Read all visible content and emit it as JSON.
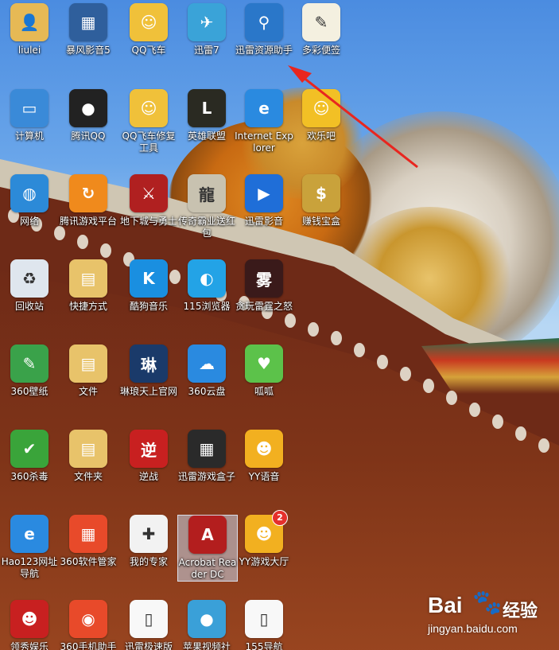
{
  "desktop": {
    "icons": [
      {
        "id": "liulei",
        "label": "liulei",
        "icon": "user-folder-icon",
        "color": "#e6b955"
      },
      {
        "id": "baofeng",
        "label": "暴风影音5",
        "icon": "film-icon",
        "color": "#2f5f9c"
      },
      {
        "id": "qqspeed",
        "label": "QQ飞车",
        "icon": "game-avatar-icon",
        "color": "#f0c13a"
      },
      {
        "id": "xunlei7",
        "label": "迅雷7",
        "icon": "bird-icon",
        "color": "#3aa3d8"
      },
      {
        "id": "xlzyzs",
        "label": "迅雷资源助手",
        "icon": "search-icon",
        "color": "#2a77c9"
      },
      {
        "id": "dcbq",
        "label": "多彩便签",
        "icon": "notepad-icon",
        "color": "#f4f0e0"
      },
      {
        "id": "computer",
        "label": "计算机",
        "icon": "computer-icon",
        "color": "#3a8ad8"
      },
      {
        "id": "tencentqq",
        "label": "腾讯QQ",
        "icon": "penguin-icon",
        "color": "#222222"
      },
      {
        "id": "qqspeedfix",
        "label": "QQ飞车修复工具",
        "icon": "game-avatar-icon",
        "color": "#f0c13a"
      },
      {
        "id": "lol",
        "label": "英雄联盟",
        "icon": "lol-icon",
        "color": "#2a2a22"
      },
      {
        "id": "ie",
        "label": "Internet Explorer",
        "icon": "ie-icon",
        "color": "#2a8ae0"
      },
      {
        "id": "huanleba",
        "label": "欢乐吧",
        "icon": "smiley-icon",
        "color": "#f2c025"
      },
      {
        "id": "network",
        "label": "网络",
        "icon": "globe-icon",
        "color": "#2c8ad8"
      },
      {
        "id": "tgp",
        "label": "腾讯游戏平台",
        "icon": "tgp-icon",
        "color": "#f08a1c"
      },
      {
        "id": "dnf",
        "label": "地下城与勇士",
        "icon": "dnf-icon",
        "color": "#b02020"
      },
      {
        "id": "cqby",
        "label": "传奇霸业送红包",
        "icon": "dragon-char-icon",
        "color": "#c8c2b0"
      },
      {
        "id": "xlyy",
        "label": "迅雷影音",
        "icon": "play-icon",
        "color": "#1f6ed8"
      },
      {
        "id": "zqbh",
        "label": "赚钱宝盒",
        "icon": "money-icon",
        "color": "#c9a23b"
      },
      {
        "id": "recycle",
        "label": "回收站",
        "icon": "recycle-bin-icon",
        "color": "#dfe6ee"
      },
      {
        "id": "shortcut",
        "label": "快捷方式",
        "icon": "folder-icon",
        "color": "#e8c36a"
      },
      {
        "id": "kugou",
        "label": "酷狗音乐",
        "icon": "k-icon",
        "color": "#1a8fe0"
      },
      {
        "id": "browser115",
        "label": "115浏览器",
        "icon": "browser-swirl-icon",
        "color": "#23a3e6"
      },
      {
        "id": "tanwan",
        "label": "贪玩雷霆之怒",
        "icon": "fog-char-icon",
        "color": "#3a1a1a"
      },
      {
        "id": "wallpaper",
        "label": "360壁纸",
        "icon": "wallpaper-icon",
        "color": "#3aa24a"
      },
      {
        "id": "wenjian",
        "label": "文件",
        "icon": "folder-icon",
        "color": "#e8c36a"
      },
      {
        "id": "linlang",
        "label": "琳琅天上官网",
        "icon": "game-logo-icon",
        "color": "#1a3a6a"
      },
      {
        "id": "yun360",
        "label": "360云盘",
        "icon": "cloud-icon",
        "color": "#2a8ae0"
      },
      {
        "id": "guagua",
        "label": "呱呱",
        "icon": "frog-icon",
        "color": "#5cc24a"
      },
      {
        "id": "safe360",
        "label": "360杀毒",
        "icon": "shield-icon",
        "color": "#3aa43a"
      },
      {
        "id": "folder",
        "label": "文件夹",
        "icon": "folder-icon",
        "color": "#e8c36a"
      },
      {
        "id": "nizhan",
        "label": "逆战",
        "icon": "nizhan-icon",
        "color": "#c82020"
      },
      {
        "id": "xlyxhz",
        "label": "迅雷游戏盒子",
        "icon": "gamebox-icon",
        "color": "#2a2a2a"
      },
      {
        "id": "yy",
        "label": "YY语音",
        "icon": "raccoon-icon",
        "color": "#f2b020"
      },
      {
        "id": "hao123",
        "label": "Hao123网址导航",
        "icon": "ie-icon",
        "color": "#2a8ae0"
      },
      {
        "id": "soft360",
        "label": "360软件管家",
        "icon": "apps-grid-icon",
        "color": "#e84a2a"
      },
      {
        "id": "expert",
        "label": "我的专家",
        "icon": "doctor-icon",
        "color": "#f2f2f2"
      },
      {
        "id": "acrobat",
        "label": "Acrobat Reader DC",
        "icon": "acrobat-icon",
        "color": "#b31e1e",
        "selected": true
      },
      {
        "id": "yygame",
        "label": "YY游戏大厅",
        "icon": "raccoon-icon",
        "color": "#f2b020",
        "badge": "2"
      },
      {
        "id": "ylmy",
        "label": "领秀娱乐",
        "icon": "avatar-icon",
        "color": "#c82020"
      },
      {
        "id": "phone360",
        "label": "360手机助手",
        "icon": "ball-icon",
        "color": "#e84a2a"
      },
      {
        "id": "xljsb",
        "label": "迅雷极速版",
        "icon": "file-icon",
        "color": "#f8f8f8"
      },
      {
        "id": "apple",
        "label": "苹果视频社",
        "icon": "apple-icon",
        "color": "#3aa0d8"
      },
      {
        "id": "nav155",
        "label": "155导航",
        "icon": "file-icon",
        "color": "#f8f8f8"
      }
    ]
  },
  "watermark": {
    "logo": "Bai",
    "logo2": "du",
    "jingyan": "经验",
    "url": "jingyan.baidu.com"
  }
}
